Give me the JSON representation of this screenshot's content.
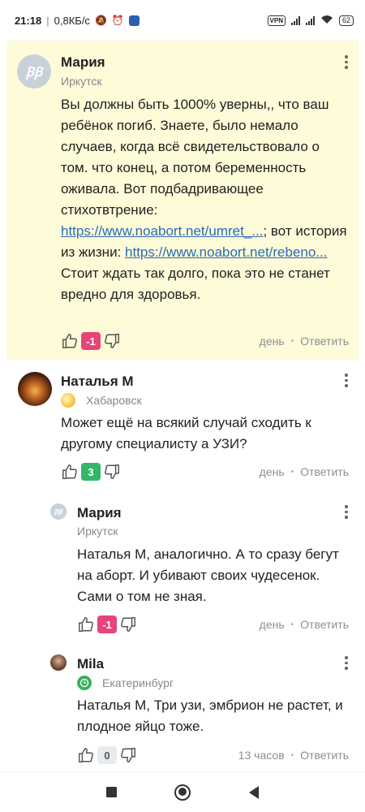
{
  "status_bar": {
    "time": "21:18",
    "speed": "0,8КБ/с",
    "vpn": "VPN",
    "battery": "62"
  },
  "comments": [
    {
      "author": "Мария",
      "avatar_initials": "ꞴꞴ",
      "city": "Иркутск",
      "text_before_link1": "Вы должны быть 1000% уверны,, что ваш ребёнок погиб. Знаете, было немало случаев, когда всё свидетельствовало о том. что конец, а потом беременность оживала. Вот подбадривающее стихотвтрение: ",
      "link1": "https://www.noabort.net/umret_...",
      "text_between": "; вот история из жизни: ",
      "link2": "https://www.noabort.net/rebeno...",
      "text_after": " Стоит ждать так долго, пока это не станет вредно для здоровья.",
      "score": "-1",
      "time": "день",
      "reply": "Ответить"
    },
    {
      "author": "Наталья М",
      "city": "Хабаровск",
      "text": "Может ещё на всякий случай сходить к другому специалисту а УЗИ?",
      "score": "3",
      "time": "день",
      "reply": "Ответить"
    },
    {
      "author": "Мария",
      "avatar_initials": "ꞴꞴ",
      "city": "Иркутск",
      "text": "Наталья М, аналогично. А то сразу бегут на аборт. И убивают своих чудесенок. Сами о том не зная.",
      "score": "-1",
      "time": "день",
      "reply": "Ответить"
    },
    {
      "author": "Mila",
      "city": "Екатеринбург",
      "text": "Наталья М, Три узи, эмбрион не растет, и плодное яйцо тоже.",
      "score": "0",
      "time": "13 часов",
      "reply": "Ответить"
    }
  ],
  "colors": {
    "highlight_bg": "#fdfbd8",
    "link": "#2a6bb5",
    "negative": "#e8437b",
    "positive": "#35b56a"
  }
}
